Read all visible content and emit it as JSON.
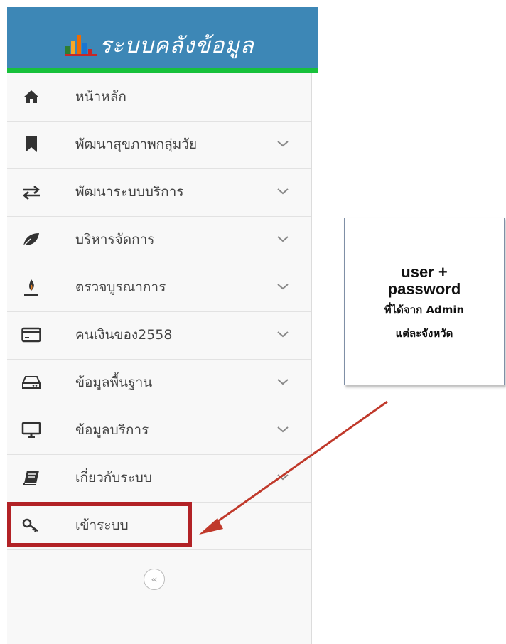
{
  "header": {
    "title": "ระบบคลังข้อมูล",
    "logo_colors": [
      "#2e7d32",
      "#f57f17",
      "#1976d2",
      "#c62828"
    ]
  },
  "sidebar": {
    "items": [
      {
        "label": "หน้าหลัก",
        "icon": "home-icon",
        "has_chevron": false
      },
      {
        "label": "พัฒนาสุขภาพกลุ่มวัย",
        "icon": "bookmark-icon",
        "has_chevron": true
      },
      {
        "label": "พัฒนาระบบบริการ",
        "icon": "exchange-arrows-icon",
        "has_chevron": true
      },
      {
        "label": "บริหารจัดการ",
        "icon": "leaf-icon",
        "has_chevron": true
      },
      {
        "label": "ตรวจบูรณาการ",
        "icon": "fire-pen-icon",
        "has_chevron": true
      },
      {
        "label": "คนเงินของ2558",
        "icon": "credit-card-icon",
        "has_chevron": true
      },
      {
        "label": "ข้อมูลพื้นฐาน",
        "icon": "hard-drive-icon",
        "has_chevron": true
      },
      {
        "label": "ข้อมูลบริการ",
        "icon": "monitor-icon",
        "has_chevron": true
      },
      {
        "label": "เกี่ยวกับระบบ",
        "icon": "book-icon",
        "has_chevron": true
      },
      {
        "label": "เข้าระบบ",
        "icon": "key-icon",
        "has_chevron": false
      }
    ],
    "collapse_label": "«"
  },
  "callout": {
    "line1": "user +",
    "line2": "password",
    "line3": "ที่ได้จาก Admin",
    "line4": "แต่ละจังหวัด"
  },
  "colors": {
    "header_bg": "#3d87b6",
    "header_accent": "#18c13b",
    "highlight": "#b22226",
    "arrow": "#c0392b"
  }
}
